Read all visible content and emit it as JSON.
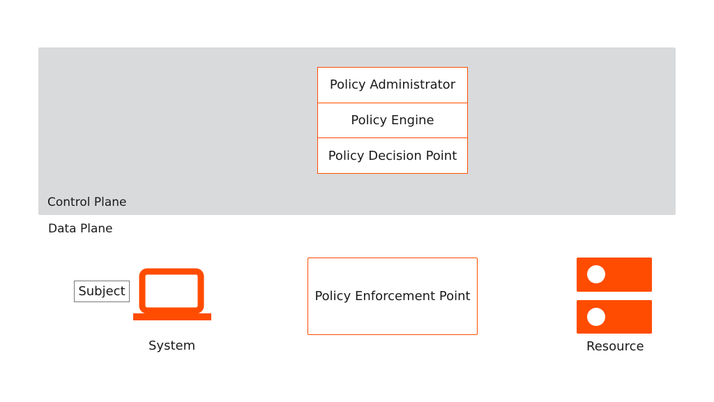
{
  "colors": {
    "accent": "#ff4c00",
    "control_plane_bg": "#d9dadc"
  },
  "control_plane": {
    "label": "Control Plane",
    "components": [
      "Policy Administrator",
      "Policy Engine",
      "Policy Decision Point"
    ]
  },
  "data_plane": {
    "label": "Data Plane",
    "pep": "Policy Enforcement Point",
    "subject": "Subject",
    "system": "System",
    "resource": "Resource"
  },
  "icons": {
    "system": "laptop-icon",
    "resource": "server-icon"
  }
}
